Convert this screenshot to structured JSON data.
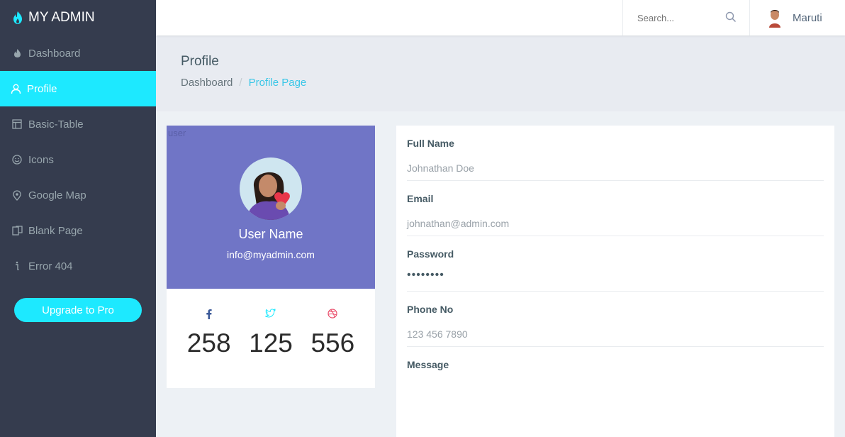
{
  "brand": {
    "title": "MY ADMIN",
    "icon": "flame-icon"
  },
  "sidebar": {
    "items": [
      {
        "label": "Dashboard",
        "icon": "fire-icon",
        "active": false
      },
      {
        "label": "Profile",
        "icon": "user-icon",
        "active": true
      },
      {
        "label": "Basic-Table",
        "icon": "layout-icon",
        "active": false
      },
      {
        "label": "Icons",
        "icon": "smile-icon",
        "active": false
      },
      {
        "label": "Google Map",
        "icon": "location-pin-icon",
        "active": false
      },
      {
        "label": "Blank Page",
        "icon": "pages-icon",
        "active": false
      },
      {
        "label": "Error 404",
        "icon": "info-icon",
        "active": false
      }
    ],
    "upgrade_label": "Upgrade to Pro"
  },
  "topbar": {
    "search_placeholder": "Search...",
    "user_name": "Maruti"
  },
  "page": {
    "title": "Profile",
    "breadcrumb": {
      "parent": "Dashboard",
      "separator": "/",
      "current": "Profile Page"
    }
  },
  "profile_card": {
    "broken_image_alt": "user",
    "user_name": "User Name",
    "email": "info@myadmin.com",
    "stats": [
      {
        "icon": "facebook-icon",
        "value": "258"
      },
      {
        "icon": "twitter-icon",
        "value": "125"
      },
      {
        "icon": "dribbble-icon",
        "value": "556"
      }
    ]
  },
  "form": {
    "fields": [
      {
        "label": "Full Name",
        "value": "Johnathan Doe"
      },
      {
        "label": "Email",
        "value": "johnathan@admin.com"
      },
      {
        "label": "Password",
        "value": "••••••••"
      },
      {
        "label": "Phone No",
        "value": "123 456 7890"
      },
      {
        "label": "Message",
        "value": ""
      }
    ]
  },
  "colors": {
    "sidebar_bg": "#353c4e",
    "accent": "#1de9ff",
    "profile_bg": "#7075c6",
    "page_bg": "#edf1f5"
  }
}
